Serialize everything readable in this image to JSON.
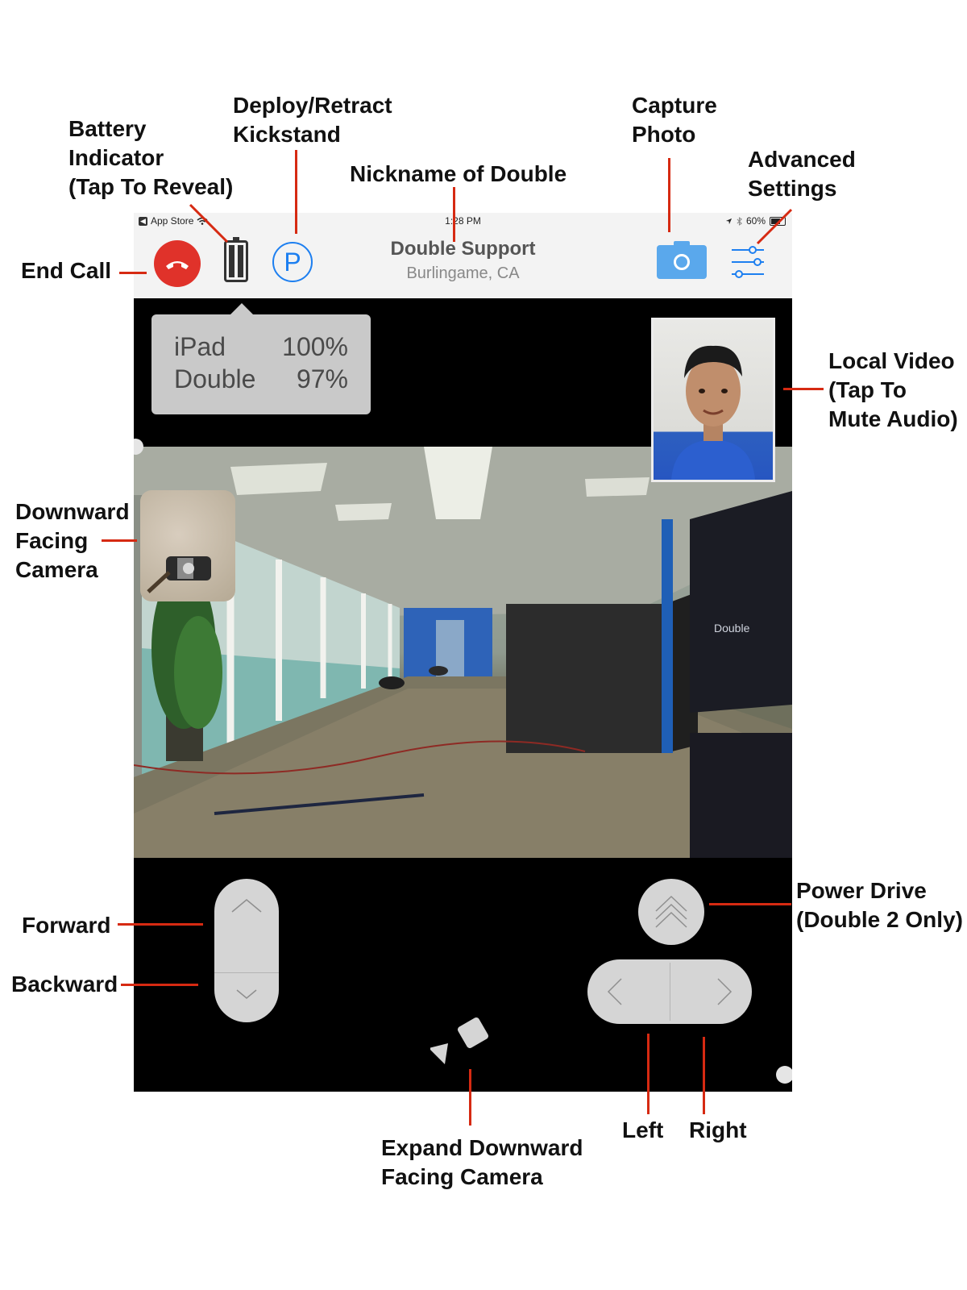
{
  "annotations": {
    "battery_indicator": [
      "Battery",
      "Indicator",
      "(Tap To Reveal)"
    ],
    "kickstand": [
      "Deploy/Retract",
      "Kickstand"
    ],
    "nickname": [
      "Nickname of Double"
    ],
    "capture_photo": [
      "Capture",
      "Photo"
    ],
    "advanced_settings": [
      "Advanced",
      "Settings"
    ],
    "end_call": [
      "End Call"
    ],
    "local_video": [
      "Local Video",
      "(Tap To",
      "Mute Audio)"
    ],
    "downward_camera": [
      "Downward",
      "Facing",
      "Camera"
    ],
    "forward": [
      "Forward"
    ],
    "backward": [
      "Backward"
    ],
    "power_drive": [
      "Power Drive",
      "(Double 2 Only)"
    ],
    "expand_camera": [
      "Expand Downward",
      "Facing Camera"
    ],
    "left": [
      "Left"
    ],
    "right": [
      "Right"
    ]
  },
  "status_bar": {
    "back_label": "App Store",
    "time": "1:28 PM",
    "battery_percent": "60%"
  },
  "header": {
    "nickname": "Double Support",
    "location": "Burlingame, CA",
    "kickstand_glyph": "P"
  },
  "battery_popup": {
    "rows": [
      {
        "label": "iPad",
        "value": "100%"
      },
      {
        "label": "Double",
        "value": "97%"
      }
    ]
  },
  "remote_feed": {
    "wall_sign": "Double"
  },
  "icons": {
    "end_call": "phone-hangup-icon",
    "battery": "battery-icon",
    "kickstand": "parking-p-icon",
    "camera": "camera-icon",
    "settings": "sliders-icon",
    "forward": "chevron-up-icon",
    "backward": "chevron-down-icon",
    "power_drive": "double-chevron-up-icon",
    "left": "chevron-left-icon",
    "right": "chevron-right-icon",
    "expand_camera": "video-camera-icon"
  },
  "colors": {
    "annotation_line": "#d62a12",
    "end_call": "#e0322a",
    "accent_blue": "#1d7ff0",
    "camera_button": "#5aa8ec",
    "control_gray": "#d5d5d5"
  }
}
